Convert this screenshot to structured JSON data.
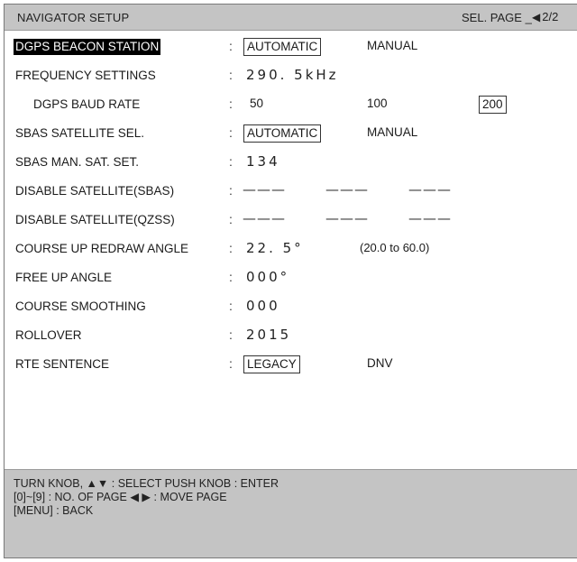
{
  "header": {
    "title": "NAVIGATOR SETUP",
    "sel_page": "SEL. PAGE _",
    "page_indicator": "2/2",
    "page_arrow": "◀"
  },
  "rows": [
    {
      "label": "DGPS BEACON STATION",
      "selected": true,
      "options": [
        "AUTOMATIC",
        "MANUAL"
      ],
      "boxed": "AUTOMATIC"
    },
    {
      "label": "FREQUENCY SETTINGS",
      "value": "290. 5kHz"
    },
    {
      "label": "DGPS BAUD RATE",
      "options": [
        "50",
        "100",
        "200"
      ],
      "boxed": "200"
    },
    {
      "label": "SBAS SATELLITE SEL.",
      "options": [
        "AUTOMATIC",
        "MANUAL"
      ],
      "boxed": "AUTOMATIC"
    },
    {
      "label": "SBAS MAN. SAT. SET.",
      "value": "134"
    },
    {
      "label": "DISABLE SATELLITE(SBAS)",
      "dashes": [
        "———",
        "———",
        "———"
      ]
    },
    {
      "label": "DISABLE SATELLITE(QZSS)",
      "dashes": [
        "———",
        "———",
        "———"
      ]
    },
    {
      "label": "COURSE UP REDRAW ANGLE",
      "value": "22. 5°",
      "range": "(20.0 to 60.0)"
    },
    {
      "label": "FREE UP ANGLE",
      "value": "000°"
    },
    {
      "label": "COURSE SMOOTHING",
      "value": "000"
    },
    {
      "label": "ROLLOVER",
      "value": "2015"
    },
    {
      "label": "RTE SENTENCE",
      "options": [
        "LEGACY",
        "DNV"
      ],
      "boxed": "LEGACY"
    }
  ],
  "colon": ":",
  "footer": {
    "line1": "TURN KNOB, ▲▼ : SELECT     PUSH KNOB : ENTER",
    "line2": "[0]~[9] : NO. OF PAGE    ◀ ▶ : MOVE PAGE",
    "line3": "[MENU] : BACK"
  }
}
